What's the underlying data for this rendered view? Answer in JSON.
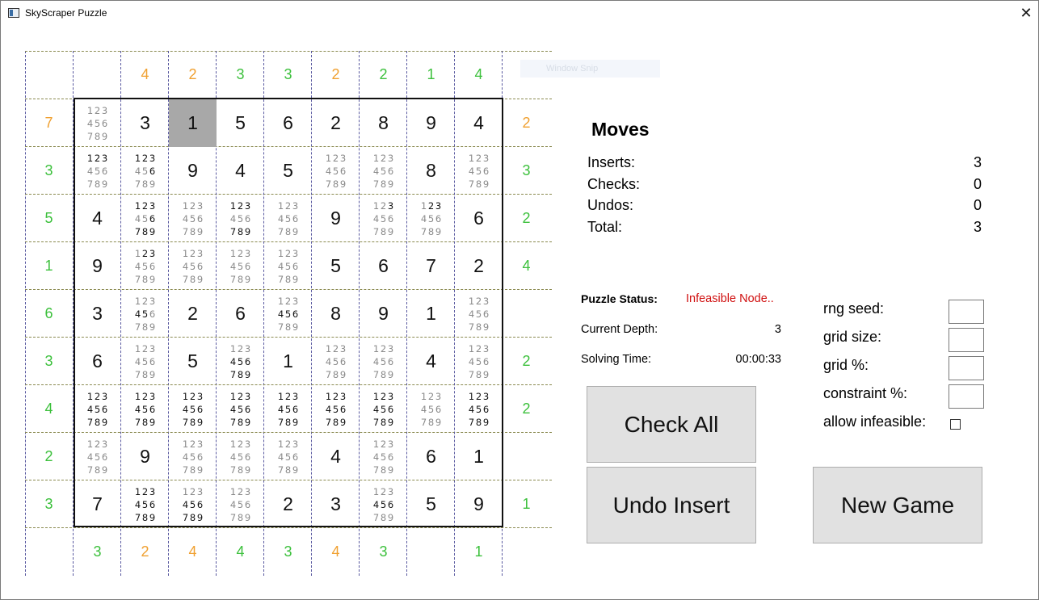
{
  "window": {
    "title": "SkyScraper Puzzle",
    "close_glyph": "✕"
  },
  "snip_overlay": "Window Snip",
  "clues": {
    "top": [
      {
        "v": "4",
        "c": "#f0a030"
      },
      {
        "v": "2",
        "c": "#f0a030"
      },
      {
        "v": "3",
        "c": "#3cc03c"
      },
      {
        "v": "3",
        "c": "#3cc03c"
      },
      {
        "v": "2",
        "c": "#f0a030"
      },
      {
        "v": "2",
        "c": "#3cc03c"
      },
      {
        "v": "1",
        "c": "#3cc03c"
      },
      {
        "v": "4",
        "c": "#3cc03c"
      }
    ],
    "top_offset": 1,
    "left": [
      {
        "v": "7",
        "c": "#f0a030"
      },
      {
        "v": "3",
        "c": "#3cc03c"
      },
      {
        "v": "5",
        "c": "#3cc03c"
      },
      {
        "v": "1",
        "c": "#3cc03c"
      },
      {
        "v": "6",
        "c": "#3cc03c"
      },
      {
        "v": "3",
        "c": "#3cc03c"
      },
      {
        "v": "4",
        "c": "#3cc03c"
      },
      {
        "v": "2",
        "c": "#3cc03c"
      },
      {
        "v": "3",
        "c": "#3cc03c"
      }
    ],
    "right": [
      {
        "v": "2",
        "c": "#f0a030"
      },
      {
        "v": "3",
        "c": "#3cc03c"
      },
      {
        "v": "2",
        "c": "#3cc03c"
      },
      {
        "v": "4",
        "c": "#3cc03c"
      },
      {
        "v": "",
        "c": "#3cc03c"
      },
      {
        "v": "2",
        "c": "#3cc03c"
      },
      {
        "v": "2",
        "c": "#3cc03c"
      },
      {
        "v": "",
        "c": "#3cc03c"
      },
      {
        "v": "1",
        "c": "#3cc03c"
      }
    ],
    "bottom": [
      {
        "v": "3",
        "c": "#3cc03c"
      },
      {
        "v": "2",
        "c": "#f0a030"
      },
      {
        "v": "4",
        "c": "#f0a030"
      },
      {
        "v": "4",
        "c": "#3cc03c"
      },
      {
        "v": "3",
        "c": "#3cc03c"
      },
      {
        "v": "4",
        "c": "#f0a030"
      },
      {
        "v": "3",
        "c": "#3cc03c"
      },
      {
        "v": "",
        "c": "#3cc03c"
      },
      {
        "v": "1",
        "c": "#3cc03c"
      }
    ]
  },
  "grid": [
    [
      "C:123456789:",
      "3",
      "1",
      "5",
      "6",
      "2",
      "8",
      "9",
      "4"
    ],
    [
      "C:123456789:123",
      "C:123456789:1236",
      "9",
      "4",
      "5",
      "C:123456789:",
      "C:123456789:",
      "8",
      "C:123456789:"
    ],
    [
      "4",
      "C:123456789:1236789",
      "C:123456789:",
      "C:123456789:123789",
      "C:123456789:",
      "9",
      "C:123456789:3",
      "C:123456789:23",
      "6"
    ],
    [
      "9",
      "C:123456789:23",
      "C:123456789:",
      "C:123456789:",
      "C:123456789:",
      "5",
      "6",
      "7",
      "2"
    ],
    [
      "3",
      "C:123456789:45",
      "2",
      "6",
      "C:123456789:456",
      "8",
      "9",
      "1",
      "C:123456789:"
    ],
    [
      "6",
      "C:123456789:",
      "5",
      "C:123456789:456789",
      "1",
      "C:123456789:",
      "C:123456789:",
      "4",
      "C:123456789:"
    ],
    [
      "C:123456789:123456789",
      "C:123456789:123456789",
      "C:123456789:123456789",
      "C:123456789:123456789",
      "C:123456789:123456789",
      "C:123456789:123456789",
      "C:123456789:123456789",
      "C:123456789:",
      "C:123456789:123456789"
    ],
    [
      "C:123456789:",
      "9",
      "C:123456789:",
      "C:123456789:",
      "C:123456789:",
      "4",
      "C:123456789:",
      "6",
      "1"
    ],
    [
      "7",
      "C:123456789:123456789",
      "C:123456789:456789",
      "C:123456789:",
      "2",
      "3",
      "C:123456789:456",
      "5",
      "9"
    ]
  ],
  "selected_cell": [
    0,
    2
  ],
  "moves": {
    "title": "Moves",
    "rows": [
      {
        "label": "Inserts:",
        "value": "3"
      },
      {
        "label": "Checks:",
        "value": "0"
      },
      {
        "label": "Undos:",
        "value": "0"
      },
      {
        "label": "Total:",
        "value": "3"
      }
    ]
  },
  "status": {
    "label": "Puzzle Status:",
    "value": "Infeasible Node..",
    "depth_label": "Current Depth:",
    "depth_value": "3",
    "time_label": "Solving Time:",
    "time_value": "00:00:33"
  },
  "buttons": {
    "check_all": "Check All",
    "undo_insert": "Undo Insert",
    "new_game": "New Game"
  },
  "options": {
    "rng_seed": "rng seed:",
    "grid_size": "grid size:",
    "grid_pct": "grid %:",
    "constraint_pct": "constraint %:",
    "allow_infeasible": "allow infeasible:"
  }
}
